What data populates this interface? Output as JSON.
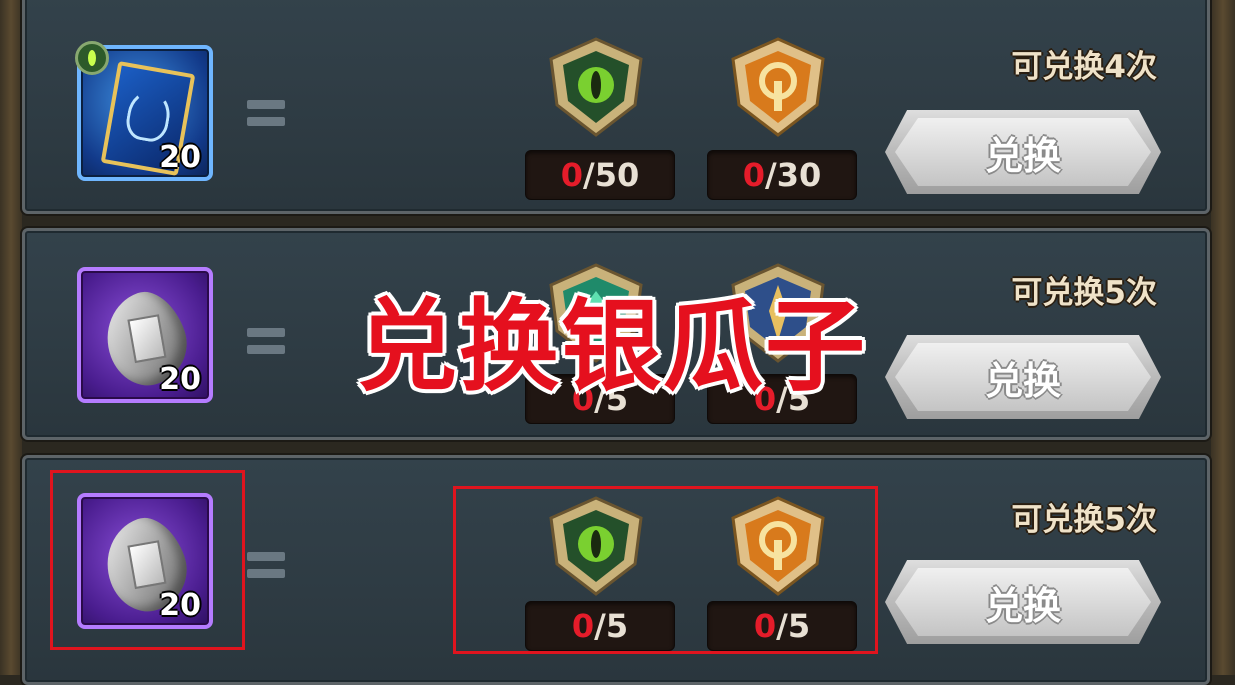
{
  "overlay": {
    "title": "兑换银瓜子"
  },
  "rows": [
    {
      "item": {
        "icon": "hero-card-icon",
        "count": "20",
        "rarity_color": "#3e8fe0"
      },
      "costs": [
        {
          "icon": "green-eye-shield-icon",
          "have": "0",
          "need": "/50"
        },
        {
          "icon": "orange-gold-shield-icon",
          "have": "0",
          "need": "/30"
        }
      ],
      "limit": "可兑换4次",
      "button": "兑换"
    },
    {
      "item": {
        "icon": "silver-seed-icon",
        "count": "20",
        "rarity_color": "#8a4fd8"
      },
      "costs": [
        {
          "icon": "teal-shield-icon",
          "have": "0",
          "need": "/5"
        },
        {
          "icon": "blue-shield-icon",
          "have": "0",
          "need": "/5"
        }
      ],
      "limit": "可兑换5次",
      "button": "兑换"
    },
    {
      "item": {
        "icon": "silver-seed-icon",
        "count": "20",
        "rarity_color": "#8a4fd8"
      },
      "costs": [
        {
          "icon": "green-eye-shield-icon",
          "have": "0",
          "need": "/5"
        },
        {
          "icon": "orange-gold-shield-icon",
          "have": "0",
          "need": "/5"
        }
      ],
      "limit": "可兑换5次",
      "button": "兑换"
    }
  ],
  "colors": {
    "have_red": "#e51c2a",
    "highlight_red": "#e0141e",
    "overlay_red": "#e5101e"
  }
}
